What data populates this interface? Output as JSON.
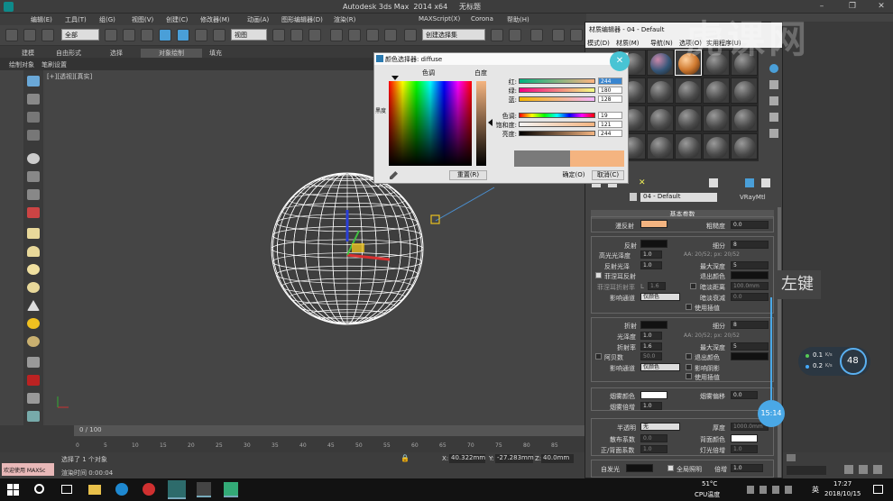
{
  "window": {
    "title": "Autodesk 3ds Max  2014 x64     无标题"
  },
  "menu": [
    "编辑(E)",
    "工具(T)",
    "组(G)",
    "视图(V)",
    "创建(C)",
    "修改器(M)",
    "动画(A)",
    "图形编辑器(D)",
    "渲染(R)",
    "MAXScript(X)",
    "Corona",
    "帮助(H)"
  ],
  "toolbar": {
    "filter": "全部",
    "refcoord": "视图",
    "selset": "创建选择集"
  },
  "ribbon": {
    "tabs": [
      "建模",
      "自由形式",
      "选择",
      "对象绘制",
      "填充"
    ],
    "sub": [
      "绘制对象",
      "笔刷设置"
    ]
  },
  "viewport": {
    "label": "[+][透视][真实]"
  },
  "timeline": {
    "frame": "0 / 100",
    "ticks": [
      "0",
      "5",
      "10",
      "15",
      "20",
      "25",
      "30",
      "35",
      "40",
      "45",
      "50",
      "55",
      "60",
      "65",
      "70",
      "75",
      "80",
      "85"
    ]
  },
  "status": {
    "welcome": "欢迎使用 MAXSc",
    "selected": "选择了 1 个对象",
    "render_time": "渲染时间 0:00:04",
    "x": "40.322mm",
    "y": "-27.283mm",
    "z": "40.0mm"
  },
  "colorpicker": {
    "title": "颜色选择器: diffuse",
    "hue_label": "色调",
    "white_label": "白度",
    "black_label": "黑度",
    "channels": [
      {
        "label": "红:",
        "value": "244"
      },
      {
        "label": "绿:",
        "value": "180"
      },
      {
        "label": "蓝:",
        "value": "128"
      },
      {
        "label": "色调:",
        "value": "19"
      },
      {
        "label": "饱和度:",
        "value": "121"
      },
      {
        "label": "亮度:",
        "value": "244"
      }
    ],
    "reset": "重置(R)",
    "ok": "确定(O)",
    "cancel": "取消(C)",
    "old_color": "#7a7a7a",
    "new_color": "#f4b480"
  },
  "mateditor": {
    "title": "材质编辑器 - 04 - Default",
    "menu": [
      "模式(D)",
      "材质(M)",
      "导航(N)",
      "选项(O)",
      "实用程序(U)"
    ],
    "material_name": "04 - Default",
    "material_type": "VRayMtl",
    "rollout": "基本参数",
    "diffuse_label": "漫反射",
    "roughness_label": "粗糙度",
    "roughness_value": "0.0",
    "diffuse_color": "#f4b480",
    "reflect": {
      "label": "反射",
      "subdiv_label": "细分",
      "subdiv": "8",
      "hilight_label": "高光光泽度",
      "hilight": "1.0",
      "aa": "AA: 20/52; px: 20/52",
      "gloss_label": "反射光泽",
      "gloss": "1.0",
      "maxdepth_label": "最大深度",
      "maxdepth": "5",
      "fresnel": "菲涅耳反射",
      "exitcolor": "退出颜色",
      "fresnel_ior_label": "菲涅耳折射率",
      "fresnel_ior": "1.6",
      "dim_label": "暗淡距离",
      "dim": "100.0mm",
      "affect_label": "影响通道",
      "affect": "仅颜色",
      "dimfall_label": "暗淡衰减",
      "dimfall": "0.0",
      "interp": "使用插值"
    },
    "refract": {
      "label": "折射",
      "subdiv_label": "细分",
      "subdiv": "8",
      "gloss_label": "光泽度",
      "gloss": "1.0",
      "aa": "AA: 20/52; px: 20/52",
      "ior_label": "折射率",
      "ior": "1.6",
      "maxdepth_label": "最大深度",
      "maxdepth": "5",
      "abbe_label": "阿贝数",
      "abbe": "50.0",
      "exitcolor": "退出颜色",
      "affect_label": "影响通道",
      "affect": "仅颜色",
      "shadows": "影响阴影",
      "interp": "使用插值"
    },
    "fog": {
      "color_label": "烟雾颜色",
      "mult_label": "烟雾倍增",
      "mult": "1.0",
      "bias_label": "烟雾偏移",
      "bias": "0.0"
    },
    "translucency": {
      "label": "半透明",
      "type": "无",
      "scatter_label": "散布系数",
      "scatter": "0.0",
      "fb_label": "正/背面系数",
      "fb": "1.0",
      "thickness_label": "厚度",
      "thickness": "1000.0mm",
      "backcolor_label": "背面颜色",
      "lightmult_label": "灯光倍增",
      "lightmult": "1.0"
    },
    "selfillum": {
      "label": "自发光",
      "gi": "全局照明",
      "mult_label": "倍增",
      "mult": "1.0"
    }
  },
  "overlay": {
    "annotation": "左键",
    "timer": "15:14",
    "net_up": "0.1",
    "net_up_unit": "K/s",
    "net_down": "0.2",
    "net_down_unit": "K/s",
    "cpu_pct": "48",
    "watermark": "虎课网"
  },
  "taskbar": {
    "temp": "51°C",
    "cpu_label": "CPU温度",
    "ime": "英",
    "time": "17:27",
    "date": "2018/10/15"
  }
}
